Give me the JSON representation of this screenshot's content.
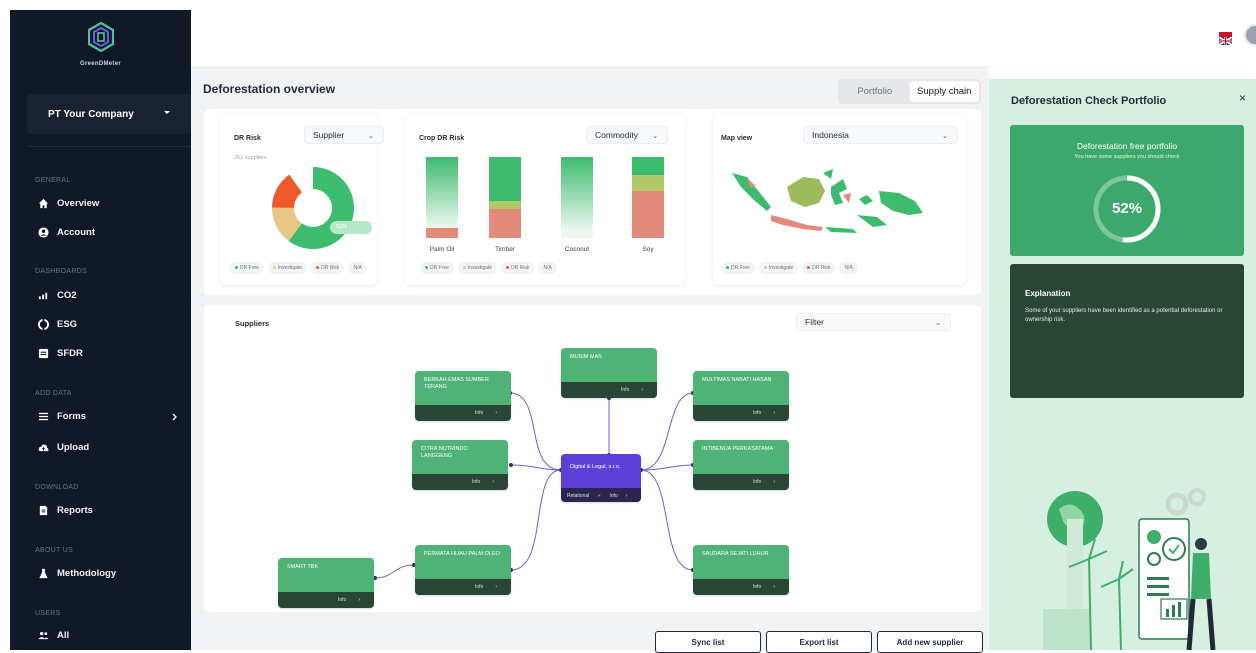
{
  "sidebar": {
    "logo_text": "GreenDMeter",
    "company": "PT Your Company",
    "sections": [
      {
        "label": "GENERAL",
        "items": [
          {
            "label": "Overview",
            "icon": "home-icon"
          },
          {
            "label": "Account",
            "icon": "user-circle-icon"
          }
        ]
      },
      {
        "label": "DASHBOARDS",
        "items": [
          {
            "label": "CO2",
            "icon": "co2-icon"
          },
          {
            "label": "ESG",
            "icon": "esg-icon"
          },
          {
            "label": "SFDR",
            "icon": "sfdr-icon"
          }
        ]
      },
      {
        "label": "ADD DATA",
        "items": [
          {
            "label": "Forms",
            "icon": "list-icon"
          },
          {
            "label": "Upload",
            "icon": "cloud-upload-icon"
          }
        ]
      },
      {
        "label": "DOWNLOAD",
        "items": [
          {
            "label": "Reports",
            "icon": "document-icon"
          }
        ]
      },
      {
        "label": "ABOUT US",
        "items": [
          {
            "label": "Methodology",
            "icon": "flask-icon"
          }
        ]
      },
      {
        "label": "USERS",
        "items": [
          {
            "label": "All",
            "icon": "users-icon"
          }
        ]
      }
    ]
  },
  "main": {
    "title": "Deforestation overview",
    "tabs": [
      {
        "label": "Portfolio",
        "active": false
      },
      {
        "label": "Supply chain",
        "active": true
      }
    ],
    "dr_risk": {
      "title": "DR Risk",
      "select": "Supplier",
      "subtitle": "252 suppliers",
      "badge": "52%",
      "legend": [
        "DR Free",
        "Investigate",
        "DR Risk",
        "N/A"
      ]
    },
    "crop_risk": {
      "title": "Crop DR Risk",
      "select": "Commodity",
      "crops": [
        "Palm Oil",
        "Timber",
        "Coconut",
        "Soy"
      ],
      "legend": [
        "DR Free",
        "Investigate",
        "DR Risk",
        "N/A"
      ]
    },
    "map": {
      "title": "Map view",
      "select": "Indonesia",
      "legend": [
        "DR Free",
        "Investigate",
        "DR Risk",
        "N/A"
      ]
    },
    "suppliers": {
      "title": "Suppliers",
      "filter": "Filter",
      "info_label": "Info",
      "center": {
        "name": "Digital & Legal, s.r.o.",
        "tag": "Relational"
      },
      "nodes": [
        "MUSIM MAS",
        "BERKAH EMAS SUMBER TERANG",
        "MULTIMAS NABATI HASAN",
        "CITRA NUTRINDO LANGGENG",
        "INTIBENUA PERKASATAMA",
        "PERMATA HIJAU PALM OLEO",
        "SAUDARA SEJATI LUHUR",
        "SMART TBK"
      ]
    },
    "buttons": {
      "sync": "Sync list",
      "export": "Export list",
      "add": "Add new supplier"
    }
  },
  "right_panel": {
    "title": "Deforestation Check Portfolio",
    "close": "×",
    "card_title": "Deforestation free portfolio",
    "card_sub": "You have some suppliers you should check",
    "percent": "52%",
    "explanation_title": "Explanation",
    "explanation_text": "Some of your suppliers have been identified as a potential deforestation or ownership risk."
  },
  "colors": {
    "dr_free": "#3dbb6e",
    "investigate": "#e8c784",
    "dr_risk": "#f05a2a",
    "na": "#cbd5d1",
    "accent": "#5b3fd6"
  }
}
